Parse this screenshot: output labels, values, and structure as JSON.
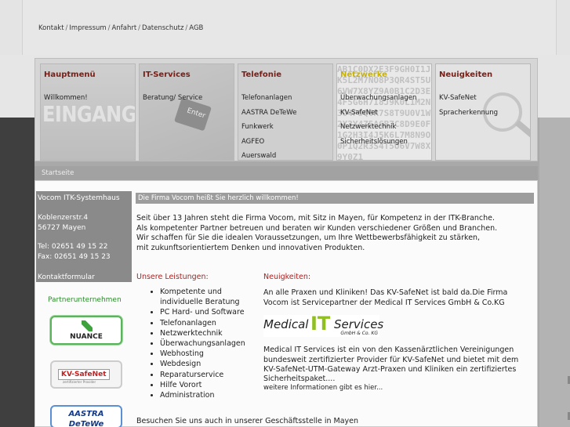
{
  "top_links": [
    "Kontakt",
    "Impressum",
    "Anfahrt",
    "Datenschutz",
    "AGB"
  ],
  "menu": [
    {
      "title": "Hauptmenü",
      "items": [
        "Willkommen!"
      ],
      "image_text": "EINGANG"
    },
    {
      "title": "IT-Services",
      "items": [
        "Beratung/ Service"
      ],
      "image_text": "Enter"
    },
    {
      "title": "Telefonie",
      "items": [
        "Telefonanlagen",
        "AASTRA DeTeWe",
        "Funkwerk",
        "AGFEO",
        "Auerswald"
      ]
    },
    {
      "title": "Netzwerke",
      "items": [
        "Überwachungsanlagen",
        "KV-SafeNet",
        "Netzwerktechnik",
        "Sicherheitslösungen"
      ]
    },
    {
      "title": "Neuigkeiten",
      "items": [
        "KV-SafeNet",
        "Spracherkennung"
      ]
    }
  ],
  "breadcrumb": "Startseite",
  "sidebar": {
    "company": "Vocom ITK-Systemhaus",
    "street": "Koblenzerstr.4",
    "city": "56727 Mayen",
    "tel": "Tel: 02651 49 15 22",
    "fax": "Fax: 02651 49 15 23",
    "contact_link": "Kontaktformular",
    "partner_heading": "Partnerunternehmen",
    "logos": [
      "NUANCE",
      "KV-SafeNet",
      "zertifizierter Provider",
      "AASTRA",
      "DeTeWe"
    ]
  },
  "main": {
    "welcome": "Die Firma Vocom heißt Sie herzlich willkommen!",
    "intro": [
      "Seit über 13 Jahren steht die Firma Vocom, mit Sitz in Mayen, für Kompetenz in der ITK-Branche.",
      "Als kompetenter Partner betreuen und beraten wir Kunden verschiedener Größen und Branchen.",
      "Wir schaffen für Sie die idealen Voraussetzungen, um Ihre Wettbewerbsfähigkeit zu stärken,",
      "mit zukunftsorientiertem Denken und innovativen Produkten."
    ],
    "services_heading": "Unsere Leistungen:",
    "services": [
      "Kompetente und",
      "individuelle Beratung",
      "PC Hard- und Software",
      "Telefonanlagen",
      "Netzwerktechnik",
      "Überwachungsanlagen",
      "Webhosting",
      "Webdesign",
      "Reparaturservice",
      "Hilfe Vorort",
      "Administration"
    ],
    "news_heading": "Neuigkeiten:",
    "news_lines": [
      "An alle Praxen  und Kliniken!  Das KV-SafeNet ist bald da.Die Firma",
      "Vocom ist Servicepartner der Medical IT Services GmbH & Co.KG"
    ],
    "mit_logo": {
      "medical": "Medical",
      "it": "IT",
      "services": "Services",
      "gmbh": "GmbH & Co. KG"
    },
    "news_lines2": [
      "Medical IT Services ist ein von den Kassenärztlichen Vereinigungen",
      "bundesweit zertifizierter Provider für KV-SafeNet und bietet mit dem",
      "KV-SafeNet-UTM-Gateway Arzt-Praxen und Kliniken ein zertifiziertes",
      "Sicherheitspaket...."
    ],
    "more_link": "weitere Informationen gibt es hier...",
    "visit": "Besuchen Sie uns auch in unserer Geschäftsstelle in Mayen"
  },
  "colors": {
    "accent_red": "#b02020",
    "partner_green": "#2c8a2c",
    "netz_yellow": "#c8b200"
  }
}
